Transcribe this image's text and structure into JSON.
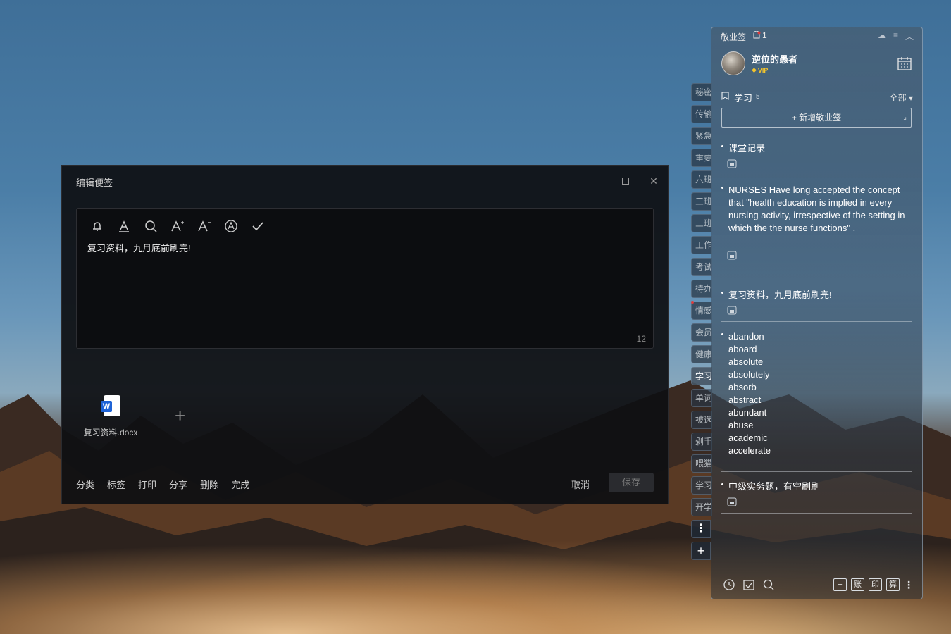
{
  "editor": {
    "title": "编辑便签",
    "content": "复习资料，九月底前刷完!",
    "char_count": "12",
    "attachment_name": "复习资料.docx",
    "attachment_badge": "W",
    "add_symbol": "+",
    "actions": [
      "分类",
      "标签",
      "打印",
      "分享",
      "删除",
      "完成"
    ],
    "cancel": "取消",
    "save": "保存",
    "toolbar_icons": [
      "bell-icon",
      "font-color-icon",
      "search-icon",
      "font-increase-icon",
      "font-decrease-icon",
      "text-style-icon",
      "check-icon"
    ]
  },
  "side_tabs": {
    "labels": [
      "秘密",
      "传输",
      "紧急",
      "重要",
      "六班",
      "三班",
      "三班",
      "工作",
      "考试",
      "待办",
      "情感",
      "会员",
      "健康",
      "学习",
      "单词",
      "被选",
      "剁手",
      "喂猫",
      "学习",
      "开学"
    ],
    "active": "学习",
    "more_symbol": "⋮",
    "add_symbol": "+"
  },
  "panel": {
    "app_name": "敬业签",
    "notify_count": "1",
    "username": "逆位的愚者",
    "vip_label": "VIP",
    "category": "学习",
    "category_count": "5",
    "filter": "全部",
    "new_note": "+ 新增敬业签",
    "notes": [
      "课堂记录",
      "NURSES Have long accepted the concept that \"health education is implied in every nursing activity, irrespective of the setting in which the the nurse functions\" .",
      "复习资料，九月底前刷完!",
      [
        "abandon",
        "aboard",
        "absolute",
        "absolutely",
        "absorb",
        "abstract",
        "abundant",
        "abuse",
        "academic",
        "accelerate"
      ],
      "中级实务题，有空刷刷"
    ],
    "footer_boxes": [
      "+",
      "账",
      "印",
      "算"
    ]
  },
  "colors": {
    "editor_bg": "#0e0f12",
    "panel_bg": "#465f76",
    "vip": "#f3c42c",
    "word_badge": "#1e63d6"
  }
}
